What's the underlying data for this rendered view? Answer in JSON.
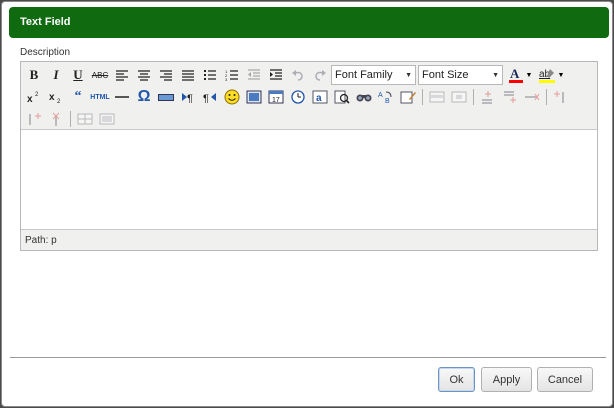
{
  "dialog": {
    "title": "Text Field",
    "field_label": "Description"
  },
  "toolbar": {
    "font_family_placeholder": "Font Family",
    "font_size_placeholder": "Font Size",
    "bold_label": "B",
    "italic_label": "I",
    "underline_label": "U",
    "strike_label": "ABC",
    "html_label": "HTML",
    "quote_label": "66",
    "font_color_label": "A",
    "highlight_label": "ab"
  },
  "editor": {
    "status_path": "Path: p"
  },
  "buttons": {
    "ok": "Ok",
    "apply": "Apply",
    "cancel": "Cancel"
  },
  "colors": {
    "title_bar": "#0f6a10",
    "font_color_swatch": "#ff0000",
    "highlight_swatch": "#ffff00"
  }
}
